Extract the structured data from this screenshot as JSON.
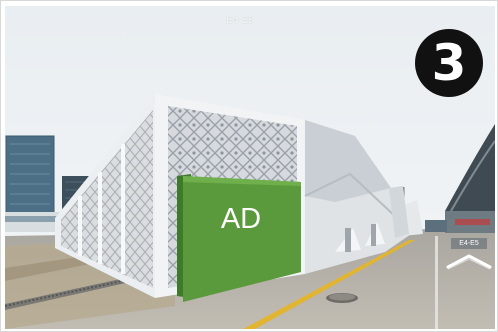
{
  "viewer": {
    "location_label": "E4-E5",
    "step_number": "❸",
    "ad_text": "AD",
    "nav_sign_text": "E4-E5",
    "nav_arrow_icon": "chevron-up-icon",
    "ad_color": "#5a9a3c"
  }
}
